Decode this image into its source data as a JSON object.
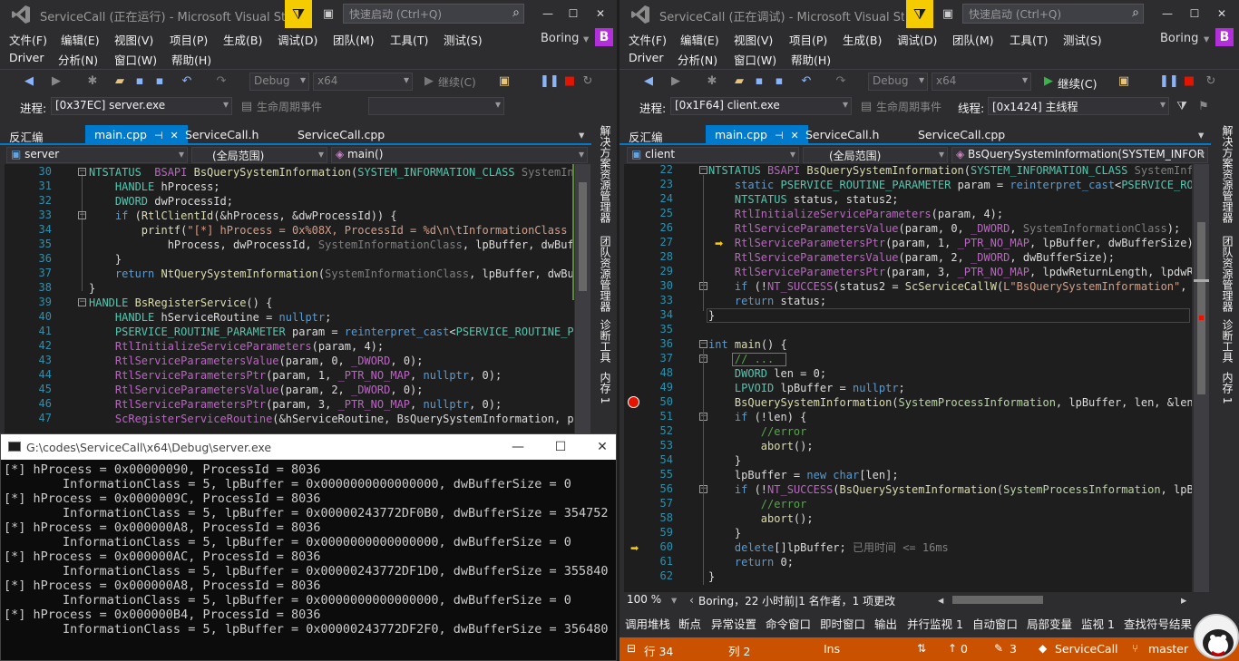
{
  "left": {
    "title": "ServiceCall (正在运行) - Microsoft Visual Stud...",
    "quick_launch": "快速启动 (Ctrl+Q)",
    "menu_row1": [
      "文件(F)",
      "编辑(E)",
      "视图(V)",
      "项目(P)",
      "生成(B)",
      "调试(D)",
      "团队(M)",
      "工具(T)",
      "测试(S)"
    ],
    "menu_row2": [
      "Driver",
      "分析(N)",
      "窗口(W)",
      "帮助(H)"
    ],
    "user": "Boring",
    "badge": "B",
    "config": "Debug",
    "platform": "x64",
    "continue_label": "继续(C)",
    "process_label": "进程:",
    "process_value": "[0x37EC] server.exe",
    "lifecycle_label": "生命周期事件",
    "tabs": [
      "反汇编",
      "main.cpp",
      "ServiceCall.h",
      "ServiceCall.cpp"
    ],
    "nav_project": "server",
    "nav_scope": "(全局范围)",
    "nav_func": "main()",
    "line_numbers": [
      "30",
      "31",
      "32",
      "33",
      "34",
      "35",
      "36",
      "37",
      "38",
      "39",
      "40",
      "41",
      "42",
      "43",
      "44",
      "45",
      "46",
      "47"
    ],
    "side_tabs": [
      "解决方案资源管理器",
      "团队资源管理器",
      "诊断工具",
      "内存 1"
    ],
    "code": [
      [
        [
          "ty",
          "NTSTATUS"
        ],
        [
          "",
          "  "
        ],
        [
          "mc",
          "BSAPI"
        ],
        [
          "",
          "",
          " "
        ],
        [
          "fn",
          "BsQuerySystemInformation"
        ],
        [
          "",
          "("
        ],
        [
          "ty",
          "SYSTEM_INFORMATION_CLASS"
        ],
        [
          "pm",
          " SystemInfor"
        ]
      ],
      [
        [
          "",
          ""
        ],
        [
          "",
          "    "
        ],
        [
          "ty",
          "HANDLE"
        ],
        [
          "",
          " hProcess;"
        ]
      ],
      [
        [
          "",
          "    "
        ],
        [
          "ty",
          "DWORD"
        ],
        [
          "",
          " dwProcessId;"
        ]
      ],
      [
        [
          "",
          "    "
        ],
        [
          "kw",
          "if"
        ],
        [
          "",
          " ("
        ],
        [
          "fn",
          "RtlClientId"
        ],
        [
          "",
          "(&hProcess, &dwProcessId)) {"
        ]
      ],
      [
        [
          "",
          "        "
        ],
        [
          "fn",
          "printf"
        ],
        [
          "",
          "("
        ],
        [
          "st",
          "\"[*] hProcess = 0x%08X, ProcessId = %d\\n\\tInformationClass = \""
        ]
      ],
      [
        [
          "",
          "            hProcess, dwProcessId, "
        ],
        [
          "pm",
          "SystemInformationClass"
        ],
        [
          "",
          ", lpBuffer, dwBuffe"
        ]
      ],
      [
        [
          "",
          "    }"
        ]
      ],
      [
        [
          "",
          "    "
        ],
        [
          "kw",
          "return"
        ],
        [
          "",
          " "
        ],
        [
          "fn",
          "NtQuerySystemInformation"
        ],
        [
          "",
          "("
        ],
        [
          "pm",
          "SystemInformationClass"
        ],
        [
          "",
          ", lpBuffer, dwBuff"
        ]
      ],
      [
        [
          "",
          "}"
        ]
      ],
      [
        [
          "ty",
          "HANDLE"
        ],
        [
          "",
          " "
        ],
        [
          "fn",
          "BsRegisterService"
        ],
        [
          "",
          "() {"
        ]
      ],
      [
        [
          "",
          "    "
        ],
        [
          "ty",
          "HANDLE"
        ],
        [
          "",
          " hServiceRoutine = "
        ],
        [
          "kw",
          "nullptr"
        ],
        [
          "",
          ";"
        ]
      ],
      [
        [
          "",
          "    "
        ],
        [
          "ty",
          "PSERVICE_ROUTINE_PARAMETER"
        ],
        [
          "",
          " param = "
        ],
        [
          "kw",
          "reinterpret_cast"
        ],
        [
          "",
          "<"
        ],
        [
          "ty",
          "PSERVICE_ROUTINE_PAR"
        ]
      ],
      [
        [
          "",
          "    "
        ],
        [
          "mc",
          "RtlInitializeServiceParameters"
        ],
        [
          "",
          "(param, 4);"
        ]
      ],
      [
        [
          "",
          "    "
        ],
        [
          "mc",
          "RtlServiceParametersValue"
        ],
        [
          "",
          "(param, 0, "
        ],
        [
          "mc",
          "_DWORD"
        ],
        [
          "",
          ", 0);"
        ]
      ],
      [
        [
          "",
          "    "
        ],
        [
          "mc",
          "RtlServiceParametersPtr"
        ],
        [
          "",
          "(param, 1, "
        ],
        [
          "mc",
          "_PTR_NO_MAP"
        ],
        [
          "",
          ", "
        ],
        [
          "kw",
          "nullptr"
        ],
        [
          "",
          ", 0);"
        ]
      ],
      [
        [
          "",
          "    "
        ],
        [
          "mc",
          "RtlServiceParametersValue"
        ],
        [
          "",
          "(param, 2, "
        ],
        [
          "mc",
          "_DWORD"
        ],
        [
          "",
          ", 0);"
        ]
      ],
      [
        [
          "",
          "    "
        ],
        [
          "mc",
          "RtlServiceParametersPtr"
        ],
        [
          "",
          "(param, 3, "
        ],
        [
          "mc",
          "_PTR_NO_MAP"
        ],
        [
          "",
          ", "
        ],
        [
          "kw",
          "nullptr"
        ],
        [
          "",
          ", 0);"
        ]
      ],
      [
        [
          "",
          "    "
        ],
        [
          "mc",
          "ScRegisterServiceRoutine"
        ],
        [
          "",
          "(&hServiceRoutine, BsQuerySystemInformation, par"
        ]
      ]
    ]
  },
  "console": {
    "title": "G:\\codes\\ServiceCall\\x64\\Debug\\server.exe",
    "lines": [
      "[*] hProcess = 0x00000090, ProcessId = 8036",
      "        InformationClass = 5, lpBuffer = 0x0000000000000000, dwBufferSize = 0",
      "[*] hProcess = 0x0000009C, ProcessId = 8036",
      "        InformationClass = 5, lpBuffer = 0x00000243772DF0B0, dwBufferSize = 354752",
      "[*] hProcess = 0x000000A8, ProcessId = 8036",
      "        InformationClass = 5, lpBuffer = 0x0000000000000000, dwBufferSize = 0",
      "[*] hProcess = 0x000000AC, ProcessId = 8036",
      "        InformationClass = 5, lpBuffer = 0x00000243772DF1D0, dwBufferSize = 355840",
      "[*] hProcess = 0x000000A8, ProcessId = 8036",
      "        InformationClass = 5, lpBuffer = 0x0000000000000000, dwBufferSize = 0",
      "[*] hProcess = 0x000000B4, ProcessId = 8036",
      "        InformationClass = 5, lpBuffer = 0x00000243772DF2F0, dwBufferSize = 356480"
    ]
  },
  "right": {
    "title": "ServiceCall (正在调试) - Microsoft Visual Stud...",
    "quick_launch": "快速启动 (Ctrl+Q)",
    "menu_row1": [
      "文件(F)",
      "编辑(E)",
      "视图(V)",
      "项目(P)",
      "生成(B)",
      "调试(D)",
      "团队(M)",
      "工具(T)",
      "测试(S)"
    ],
    "menu_row2": [
      "Driver",
      "分析(N)",
      "窗口(W)",
      "帮助(H)"
    ],
    "user": "Boring",
    "badge": "B",
    "config": "Debug",
    "platform": "x64",
    "continue_label": "继续(C)",
    "process_label": "进程:",
    "process_value": "[0x1F64] client.exe",
    "lifecycle_label": "生命周期事件",
    "thread_label": "线程:",
    "thread_value": "[0x1424] 主线程",
    "tabs": [
      "反汇编",
      "main.cpp",
      "ServiceCall.h",
      "ServiceCall.cpp"
    ],
    "nav_project": "client",
    "nav_scope": "(全局范围)",
    "nav_func": "BsQuerySystemInformation(SYSTEM_INFOR",
    "line_numbers": [
      "22",
      "23",
      "24",
      "25",
      "26",
      "27",
      "28",
      "29",
      "30",
      "33",
      "34",
      "35",
      "36",
      "37",
      "48",
      "49",
      "50",
      "51",
      "52",
      "53",
      "54",
      "55",
      "56",
      "57",
      "58",
      "59",
      "60",
      "61",
      "62"
    ],
    "side_tabs": [
      "解决方案资源管理器",
      "团队资源管理器",
      "诊断工具",
      "内存 1"
    ],
    "code": [
      [
        [
          "ty",
          "NTSTATUS"
        ],
        [
          "",
          " "
        ],
        [
          "mc",
          "BSAPI"
        ],
        [
          "",
          " "
        ],
        [
          "fn",
          "BsQuerySystemInformation"
        ],
        [
          "",
          "("
        ],
        [
          "ty",
          "SYSTEM_INFORMATION_CLASS"
        ],
        [
          "pm",
          " SystemInfor"
        ]
      ],
      [
        [
          "",
          "    "
        ],
        [
          "kw",
          "static"
        ],
        [
          "",
          " "
        ],
        [
          "ty",
          "PSERVICE_ROUTINE_PARAMETER"
        ],
        [
          "",
          " param = "
        ],
        [
          "kw",
          "reinterpret_cast"
        ],
        [
          "",
          "<"
        ],
        [
          "ty",
          "PSERVICE_ROUT"
        ]
      ],
      [
        [
          "",
          "    "
        ],
        [
          "ty",
          "NTSTATUS"
        ],
        [
          "",
          " status, status2;"
        ]
      ],
      [
        [
          "",
          "    "
        ],
        [
          "mc",
          "RtlInitializeServiceParameters"
        ],
        [
          "",
          "(param, 4);"
        ]
      ],
      [
        [
          "",
          "    "
        ],
        [
          "mc",
          "RtlServiceParametersValue"
        ],
        [
          "",
          "(param, 0, "
        ],
        [
          "mc",
          "_DWORD"
        ],
        [
          "",
          ", "
        ],
        [
          "pm",
          "SystemInformationClass"
        ],
        [
          "",
          ");"
        ]
      ],
      [
        [
          "",
          "    "
        ],
        [
          "mc",
          "RtlServiceParametersPtr"
        ],
        [
          "",
          "(param, 1, "
        ],
        [
          "mc",
          "_PTR_NO_MAP"
        ],
        [
          "",
          ", lpBuffer, dwBufferSize);"
        ]
      ],
      [
        [
          "",
          "    "
        ],
        [
          "mc",
          "RtlServiceParametersValue"
        ],
        [
          "",
          "(param, 2, "
        ],
        [
          "mc",
          "_DWORD"
        ],
        [
          "",
          ", dwBufferSize);"
        ]
      ],
      [
        [
          "",
          "    "
        ],
        [
          "mc",
          "RtlServiceParametersPtr"
        ],
        [
          "",
          "(param, 3, "
        ],
        [
          "mc",
          "_PTR_NO_MAP"
        ],
        [
          "",
          ", lpdwReturnLength, lpdwRet"
        ]
      ],
      [
        [
          "",
          "    "
        ],
        [
          "kw",
          "if"
        ],
        [
          "",
          " (!"
        ],
        [
          "mc",
          "NT_SUCCESS"
        ],
        [
          "",
          "(status2 = "
        ],
        [
          "fn",
          "ScServiceCallW"
        ],
        [
          "",
          "("
        ],
        [
          "st",
          "L\"BsQuerySystemInformation\""
        ],
        [
          "",
          ", pa"
        ]
      ],
      [
        [
          "",
          "    "
        ],
        [
          "kw",
          "return"
        ],
        [
          "",
          " status;"
        ]
      ],
      [
        [
          "",
          "}"
        ]
      ],
      [
        [
          "",
          ""
        ]
      ],
      [
        [
          "kw",
          "int"
        ],
        [
          "",
          " "
        ],
        [
          "fn",
          "main"
        ],
        [
          "",
          "() {"
        ]
      ],
      [
        [
          "",
          "    "
        ],
        [
          "cm",
          "// ..."
        ]
      ],
      [
        [
          "",
          "    "
        ],
        [
          "ty",
          "DWORD"
        ],
        [
          "",
          " len = 0;"
        ]
      ],
      [
        [
          "",
          "    "
        ],
        [
          "ty",
          "LPVOID"
        ],
        [
          "",
          " lpBuffer = "
        ],
        [
          "kw",
          "nullptr"
        ],
        [
          "",
          ";"
        ]
      ],
      [
        [
          "",
          "    "
        ],
        [
          "fn",
          "BsQuerySystemInformation"
        ],
        [
          "",
          "("
        ],
        [
          "en",
          "SystemProcessInformation"
        ],
        [
          "",
          ", lpBuffer, len, &len);"
        ]
      ],
      [
        [
          "",
          "    "
        ],
        [
          "kw",
          "if"
        ],
        [
          "",
          " (!len) {"
        ]
      ],
      [
        [
          "",
          "        "
        ],
        [
          "cm",
          "//error"
        ]
      ],
      [
        [
          "",
          "        "
        ],
        [
          "fn",
          "abort"
        ],
        [
          "",
          "();"
        ]
      ],
      [
        [
          "",
          "    }"
        ]
      ],
      [
        [
          "",
          "    lpBuffer = "
        ],
        [
          "kw",
          "new"
        ],
        [
          "",
          " "
        ],
        [
          "kw",
          "char"
        ],
        [
          "",
          "[len];"
        ]
      ],
      [
        [
          "",
          "    "
        ],
        [
          "kw",
          "if"
        ],
        [
          "",
          " (!"
        ],
        [
          "mc",
          "NT_SUCCESS"
        ],
        [
          "",
          "("
        ],
        [
          "fn",
          "BsQuerySystemInformation"
        ],
        [
          "",
          "("
        ],
        [
          "en",
          "SystemProcessInformation"
        ],
        [
          "",
          ", lpBuf"
        ]
      ],
      [
        [
          "",
          "        "
        ],
        [
          "cm",
          "//error"
        ]
      ],
      [
        [
          "",
          "        "
        ],
        [
          "fn",
          "abort"
        ],
        [
          "",
          "();"
        ]
      ],
      [
        [
          "",
          "    }"
        ]
      ],
      [
        [
          "",
          "    "
        ],
        [
          "kw",
          "delete"
        ],
        [
          "",
          "[]lpBuffer; "
        ],
        [
          "pm",
          "已用时间 <= 16ms"
        ]
      ],
      [
        [
          "",
          "    "
        ],
        [
          "kw",
          "return"
        ],
        [
          "",
          " 0;"
        ]
      ],
      [
        [
          "",
          "}"
        ]
      ]
    ],
    "zoom": "100 %",
    "codelens": "Boring，22 小时前|1 名作者，1 项更改",
    "bottom_tabs": [
      "调用堆栈",
      "断点",
      "异常设置",
      "命令窗口",
      "即时窗口",
      "输出",
      "并行监视 1",
      "自动窗口",
      "局部变量",
      "监视 1",
      "查找符号结果"
    ],
    "status": {
      "line": "行 34",
      "col": "列 2",
      "ins": "Ins",
      "up": "0",
      "pencil": "3",
      "repo": "ServiceCall",
      "branch": "master"
    }
  },
  "colors": {
    "accent": "#007acc",
    "status_debug": "#ca5100",
    "filter": "#f5cc00",
    "badge": "#b22fdb"
  }
}
